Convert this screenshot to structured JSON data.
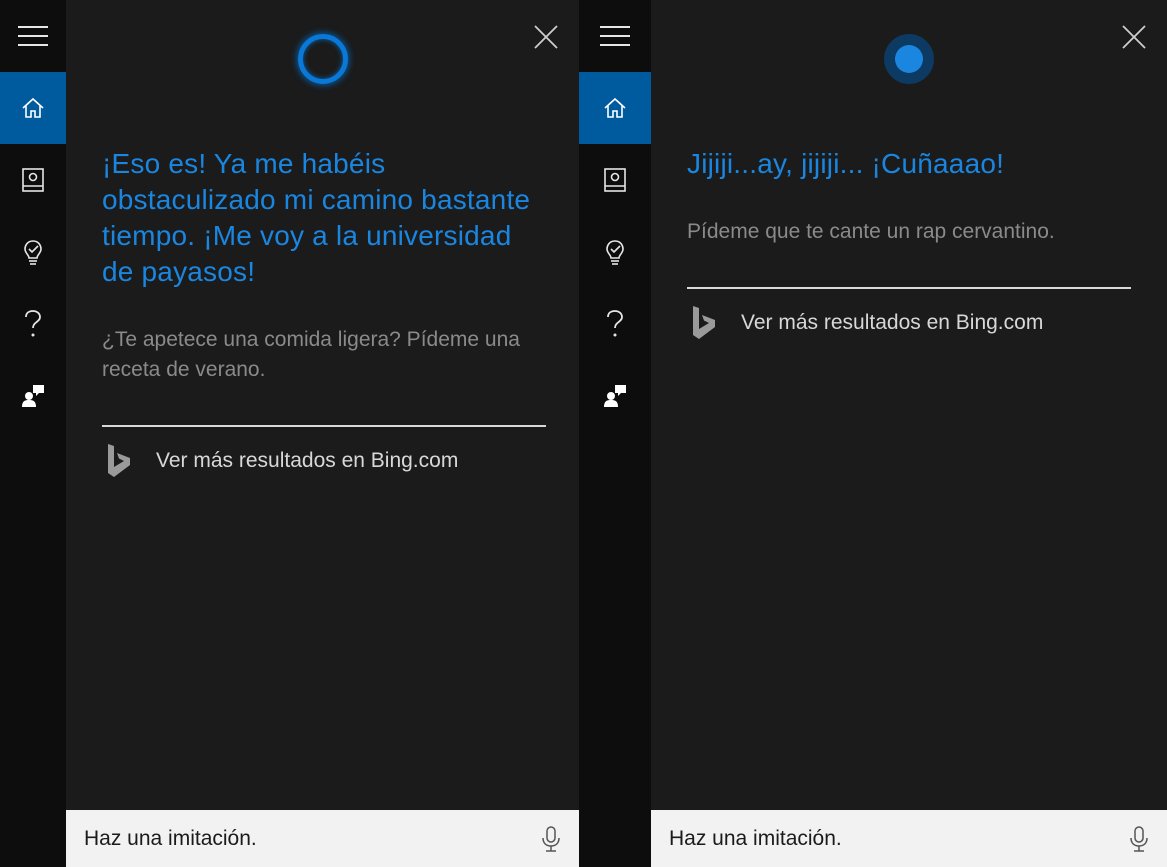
{
  "panels": [
    {
      "state": "idle",
      "response": "¡Eso es! Ya me habéis obstaculizado mi camino bastante tiempo. ¡Me voy a la universidad de payasos!",
      "suggestion": "¿Te apetece una comida ligera? Pídeme una receta de verano.",
      "bing_link": "Ver más resultados en Bing.com",
      "query": "Haz una imitación."
    },
    {
      "state": "speaking",
      "response": "Jijiji...ay, jijiji... ¡Cuñaaao!",
      "suggestion": "Pídeme que te cante un rap cervantino.",
      "bing_link": "Ver más resultados en Bing.com",
      "query": "Haz una imitación."
    }
  ],
  "rail_items": [
    {
      "icon": "hamburger-menu-icon"
    },
    {
      "icon": "home-icon",
      "selected": true
    },
    {
      "icon": "notebook-icon"
    },
    {
      "icon": "reminders-icon"
    },
    {
      "icon": "help-icon"
    },
    {
      "icon": "feedback-icon"
    }
  ],
  "colors": {
    "accent": "#0a78d6",
    "response_text": "#1a86e0",
    "rail_bg": "#0d0d0d",
    "rail_selected": "#005a9e",
    "panel_bg": "#1b1b1b",
    "search_bg": "#f2f2f2"
  }
}
